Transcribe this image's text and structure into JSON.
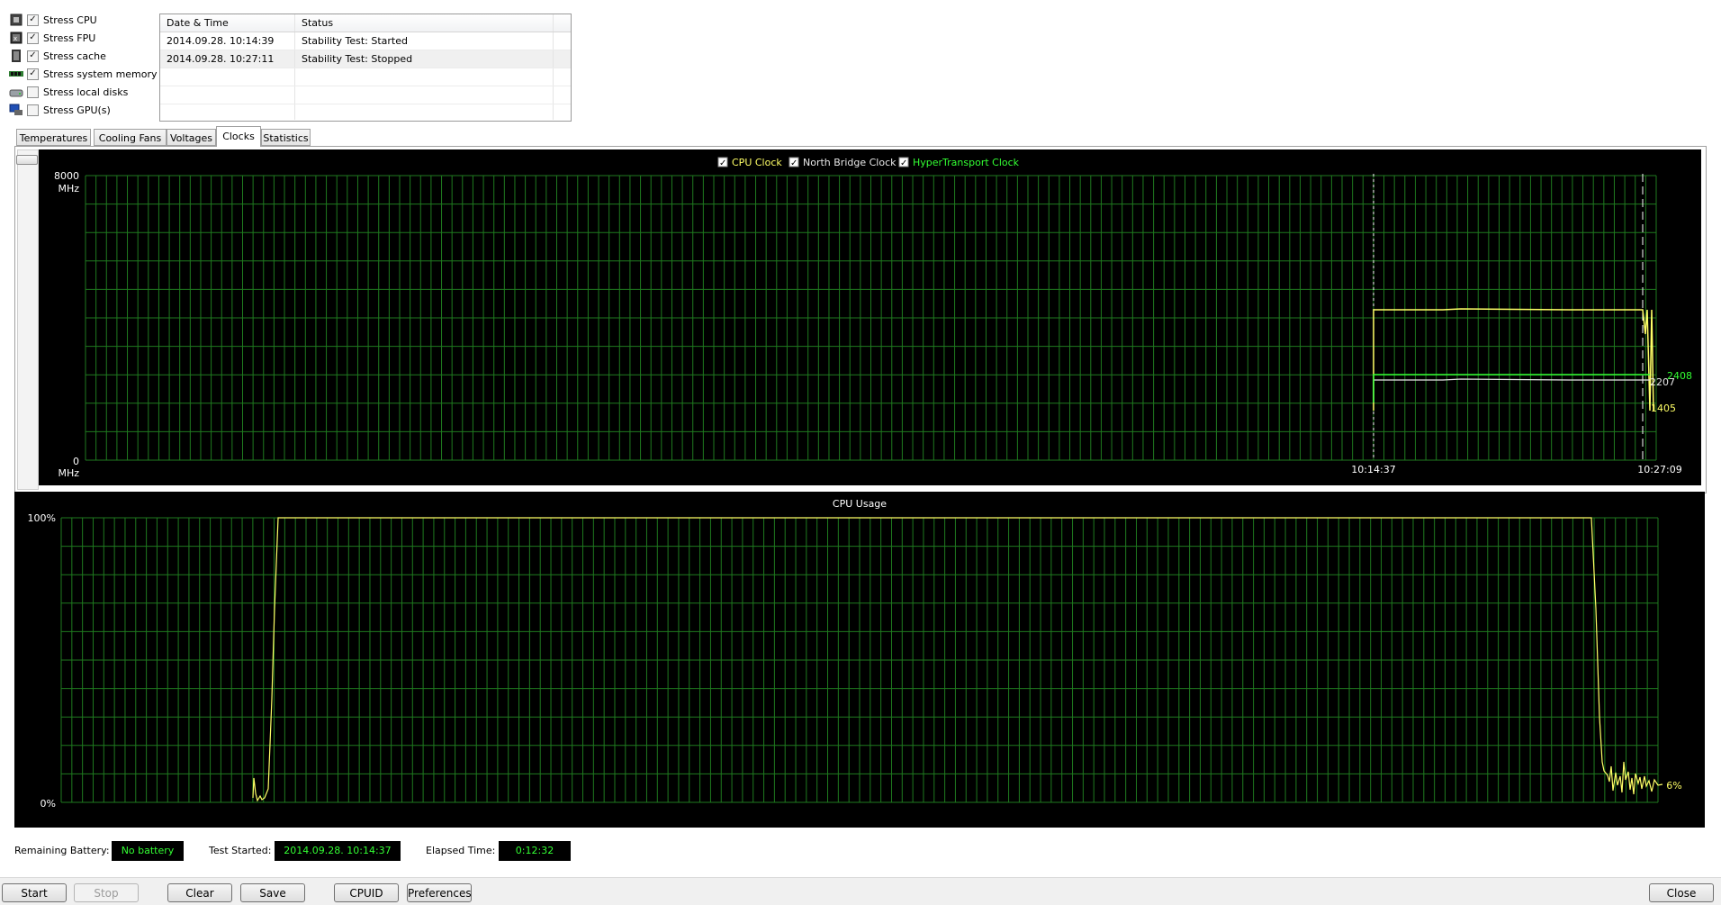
{
  "stress_options": [
    {
      "label": "Stress CPU",
      "checked": true,
      "icon": "cpu-icon"
    },
    {
      "label": "Stress FPU",
      "checked": true,
      "icon": "fpu-icon"
    },
    {
      "label": "Stress cache",
      "checked": true,
      "icon": "cache-icon"
    },
    {
      "label": "Stress system memory",
      "checked": true,
      "icon": "memory-icon"
    },
    {
      "label": "Stress local disks",
      "checked": false,
      "icon": "disk-icon"
    },
    {
      "label": "Stress GPU(s)",
      "checked": false,
      "icon": "gpu-icon"
    }
  ],
  "log": {
    "columns": [
      "Date & Time",
      "Status"
    ],
    "rows": [
      {
        "datetime": "2014.09.28. 10:14:39",
        "status": "Stability Test: Started"
      },
      {
        "datetime": "2014.09.28. 10:27:11",
        "status": "Stability Test: Stopped"
      }
    ]
  },
  "tabs": [
    {
      "label": "Temperatures",
      "active": false
    },
    {
      "label": "Cooling Fans",
      "active": false
    },
    {
      "label": "Voltages",
      "active": false
    },
    {
      "label": "Clocks",
      "active": true
    },
    {
      "label": "Statistics",
      "active": false
    }
  ],
  "clock_chart": {
    "legend": [
      {
        "label": "CPU Clock",
        "color": "#ffff66",
        "checked": true
      },
      {
        "label": "North Bridge Clock",
        "color": "#e8e8e8",
        "checked": true
      },
      {
        "label": "HyperTransport Clock",
        "color": "#33ff33",
        "checked": true
      }
    ],
    "y_top": "8000",
    "y_unit_top": "MHz",
    "y_bottom": "0",
    "y_unit_bottom": "MHz",
    "x_start": "10:14:37",
    "x_end": "10:27:09",
    "end_values": [
      {
        "series": "HyperTransport Clock",
        "value": "2408",
        "color": "#33ff33"
      },
      {
        "series": "North Bridge Clock",
        "value": "2207",
        "color": "#e8e8e8"
      },
      {
        "series": "CPU Clock",
        "value": "1405",
        "color": "#ffff66"
      }
    ]
  },
  "usage_chart": {
    "title": "CPU Usage",
    "y_top": "100%",
    "y_bottom": "0%",
    "end_value": "6%"
  },
  "chart_data": [
    {
      "type": "line",
      "title": "",
      "ylabel": "MHz",
      "ylim": [
        0,
        8000
      ],
      "x_ticks": [
        "10:14:37",
        "10:27:09"
      ],
      "series": [
        {
          "name": "CPU Clock",
          "values": [
            0,
            4200,
            4200,
            4200,
            1405
          ]
        },
        {
          "name": "North Bridge Clock",
          "values": [
            0,
            2207,
            2207,
            2207,
            2207
          ]
        },
        {
          "name": "HyperTransport Clock",
          "values": [
            0,
            2408,
            2408,
            2408,
            2408
          ]
        }
      ],
      "grid": true,
      "legend": "top-center"
    },
    {
      "type": "line",
      "title": "CPU Usage",
      "ylim": [
        0,
        100
      ],
      "series": [
        {
          "name": "CPU Usage",
          "values": [
            0,
            14,
            0,
            100,
            100,
            100,
            100,
            12,
            8,
            6
          ]
        }
      ],
      "grid": true
    }
  ],
  "status": {
    "battery_label": "Remaining Battery:",
    "battery_value": "No battery",
    "started_label": "Test Started:",
    "started_value": "2014.09.28. 10:14:37",
    "elapsed_label": "Elapsed Time:",
    "elapsed_value": "0:12:32"
  },
  "buttons": {
    "start": "Start",
    "stop": "Stop",
    "clear": "Clear",
    "save": "Save",
    "cpuid": "CPUID",
    "preferences": "Preferences",
    "close": "Close"
  }
}
